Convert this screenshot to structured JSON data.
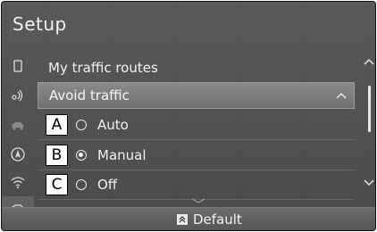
{
  "title": "Setup",
  "sidebar": {
    "icons": [
      "phone-icon",
      "voice-icon",
      "car-icon",
      "navigation-icon",
      "wifi-icon",
      "vehicle-settings-icon"
    ]
  },
  "list": {
    "heading": "My traffic routes",
    "dropdown_label": "Avoid traffic",
    "options": [
      {
        "marker": "A",
        "label": "Auto",
        "selected": false
      },
      {
        "marker": "B",
        "label": "Manual",
        "selected": true
      },
      {
        "marker": "C",
        "label": "Off",
        "selected": false
      }
    ]
  },
  "footer": {
    "default_label": "Default"
  }
}
